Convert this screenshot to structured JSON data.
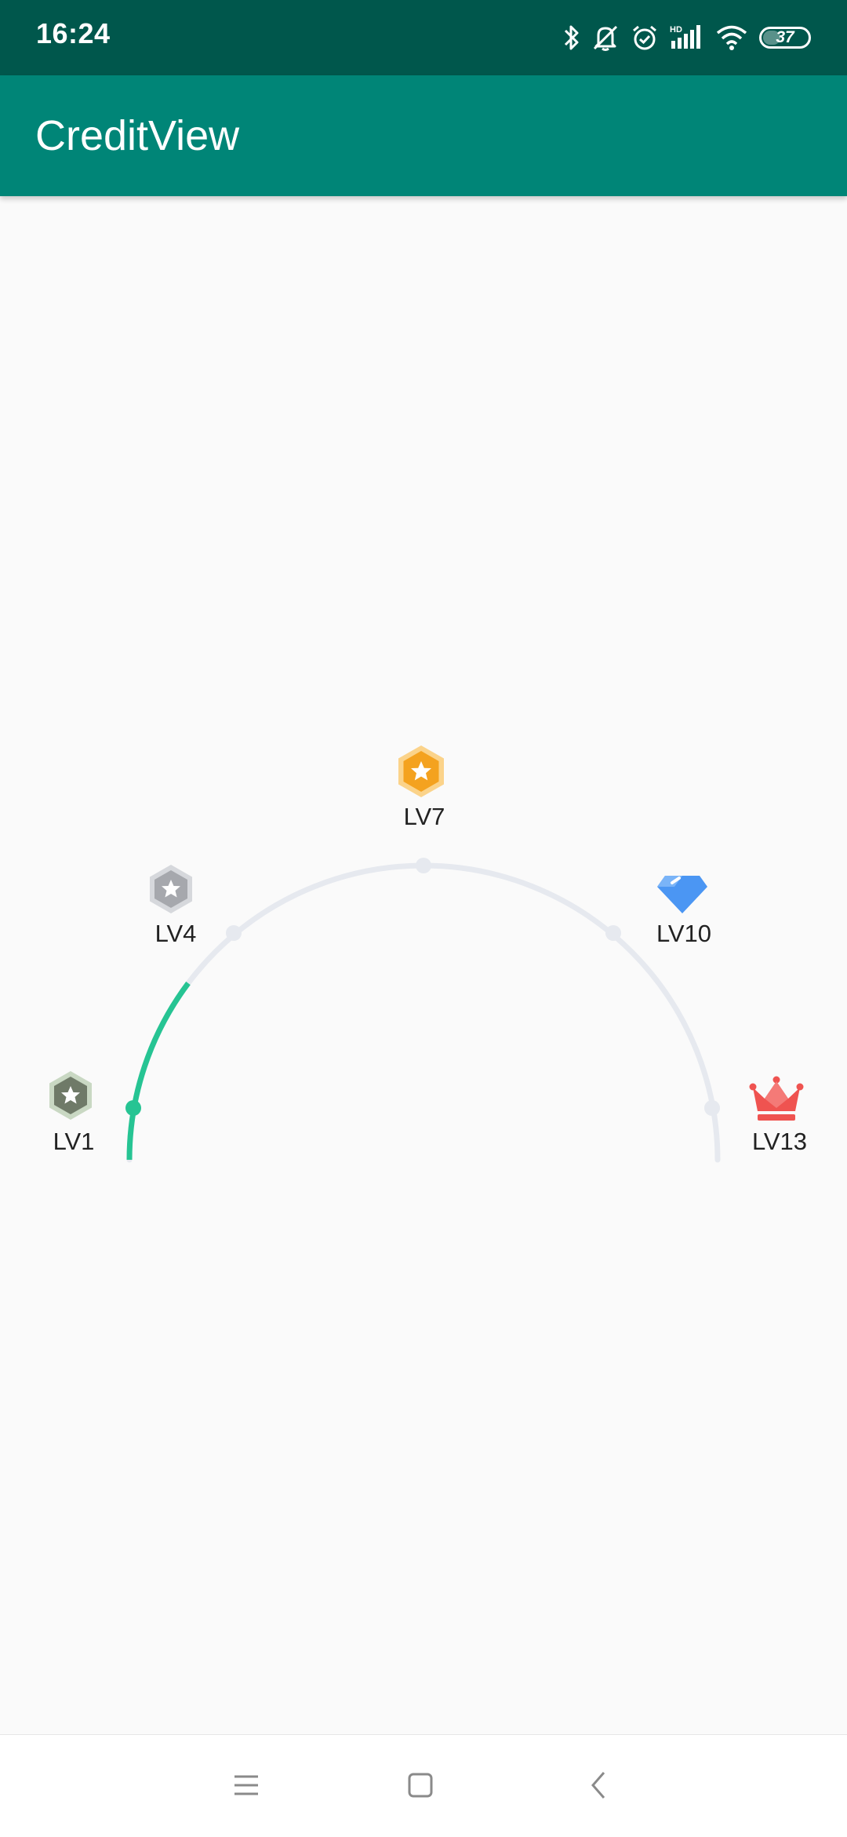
{
  "status_bar": {
    "time": "16:24",
    "hd_label": "HD",
    "battery_level": "37",
    "icons": [
      "bluetooth-icon",
      "vibrate-off-icon",
      "alarm-icon",
      "hd-signal-icon",
      "wifi-icon",
      "battery-icon"
    ]
  },
  "app_bar": {
    "title": "CreditView"
  },
  "credit_view": {
    "current_progress_fraction": 0.17,
    "progress_color": "#26c493",
    "track_color": "#e6e9ef",
    "levels": [
      {
        "label": "LV1",
        "icon": "gray-hexagon-star-badge-icon",
        "color": "#6f7a68"
      },
      {
        "label": "LV4",
        "icon": "silver-hexagon-star-badge-icon",
        "color": "#a6a8ad"
      },
      {
        "label": "LV7",
        "icon": "gold-hexagon-star-badge-icon",
        "color": "#f4a21f"
      },
      {
        "label": "LV10",
        "icon": "blue-diamond-icon",
        "color": "#4b96f3"
      },
      {
        "label": "LV13",
        "icon": "red-crown-icon",
        "color": "#ef5350"
      }
    ]
  },
  "nav_bar": {
    "buttons": [
      "menu-icon",
      "home-icon",
      "back-icon"
    ]
  }
}
